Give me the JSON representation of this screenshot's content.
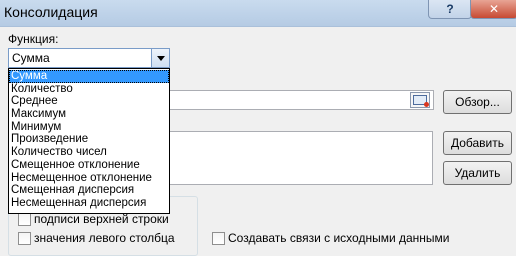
{
  "window": {
    "title": "Консолидация",
    "help_label": "?",
    "close_label": "✕"
  },
  "function": {
    "label": "Функция:",
    "selected_value": "Сумма",
    "options": [
      "Сумма",
      "Количество",
      "Среднее",
      "Максимум",
      "Минимум",
      "Произведение",
      "Количество чисел",
      "Смещенное отклонение",
      "Несмещенное отклонение",
      "Смещенная дисперсия",
      "Несмещенная дисперсия"
    ]
  },
  "reference": {
    "value": "",
    "browse_label": "Обзор..."
  },
  "ranges": {
    "add_label": "Добавить",
    "delete_label": "Удалить"
  },
  "use_labels": {
    "top_row_label": "подписи верхней строки",
    "left_column_label": "значения левого столбца",
    "top_row_checked": false,
    "left_column_checked": false
  },
  "create_links": {
    "label": "Создавать связи с исходными данными",
    "checked": false
  }
}
